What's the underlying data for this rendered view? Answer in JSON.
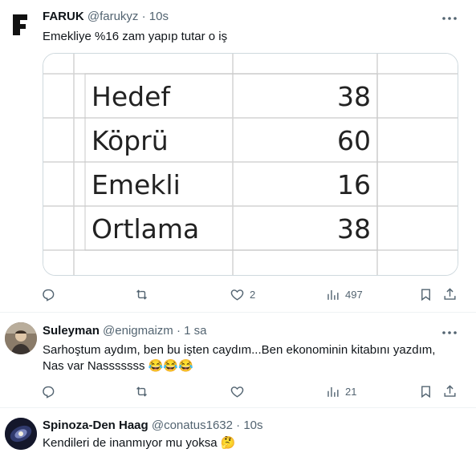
{
  "tweet1": {
    "display_name": "FARUK",
    "handle": "@farukyz",
    "separator": "·",
    "time": "10s",
    "text": "Emekliye %16 zam yapıp tutar o iş",
    "table": [
      {
        "label": "Hedef",
        "value": "38"
      },
      {
        "label": "Köprü",
        "value": "60"
      },
      {
        "label": "Emekli",
        "value": "16"
      },
      {
        "label": "Ortlama",
        "value": "38"
      }
    ],
    "likes": "2",
    "views": "497"
  },
  "tweet2": {
    "display_name": "Suleyman",
    "handle": "@enigmaizm",
    "separator": "·",
    "time": "1 sa",
    "text_line1": "Sarhoştum aydım, ben bu işten caydım...Ben ekonominin kitabını yazdım,",
    "text_line2": "Nas var Nasssssss 😂😂😂",
    "views": "21"
  },
  "tweet3": {
    "display_name": "Spinoza-Den Haag",
    "handle": "@conatus1632",
    "separator": "·",
    "time": "10s",
    "text": "Kendileri de inanmıyor mu yoksa 🤔"
  },
  "colors": {
    "text_primary": "#0f1419",
    "text_secondary": "#536471",
    "border": "#cfd9de",
    "divider": "#eff3f4"
  },
  "icons": [
    "logo-f-icon",
    "more-icon",
    "reply-icon",
    "retweet-icon",
    "like-icon",
    "views-icon",
    "bookmark-icon",
    "share-icon"
  ]
}
